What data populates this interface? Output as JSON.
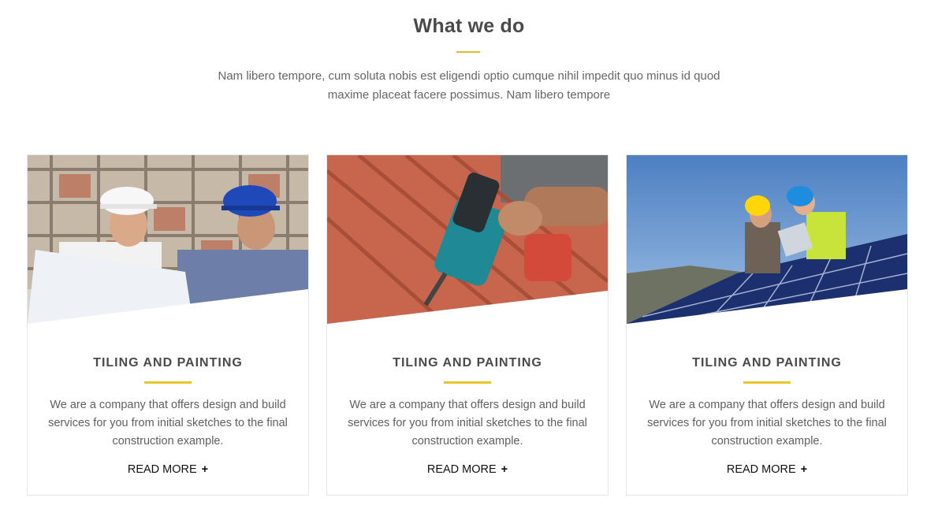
{
  "section": {
    "title": "What we do",
    "intro": "Nam libero tempore, cum soluta nobis est eligendi optio cumque nihil impedit quo minus id quod maxime placeat facere possimus. Nam libero tempore"
  },
  "cards": [
    {
      "image_subject": "engineers with hard hats reviewing blueprints at construction site",
      "title": "TILING AND PAINTING",
      "text": "We are a company that offers design and build services for you from initial sketches to the final construction example.",
      "link_label": "READ MORE",
      "link_icon": "+"
    },
    {
      "image_subject": "hand with cordless drill on red roof tiles",
      "title": "TILING AND PAINTING",
      "text": "We are a company that offers design and build services for you from initial sketches to the final construction example.",
      "link_label": "READ MORE",
      "link_icon": "+"
    },
    {
      "image_subject": "workers in hard hats installing solar panels",
      "title": "TILING AND PAINTING",
      "text": "We are a company that offers design and build services for you from initial sketches to the final construction example.",
      "link_label": "READ MORE",
      "link_icon": "+"
    }
  ],
  "colors": {
    "accent": "#e5c72c",
    "heading": "#4a4a4a",
    "body_text": "#5f5f5f",
    "border": "#e6e6e6"
  }
}
